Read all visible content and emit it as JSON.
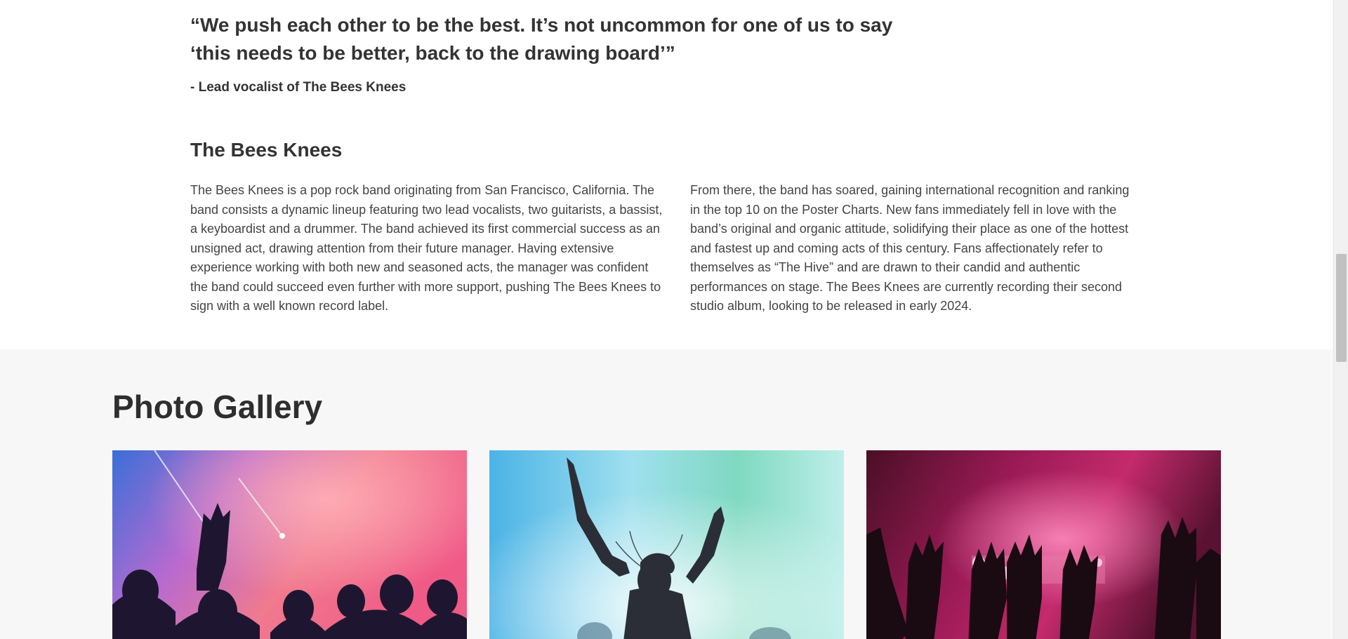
{
  "quote": {
    "text": "“We push each other to be the best. It’s not uncommon for one of us to say ‘this needs to be better, back to the drawing board’”",
    "attribution": "- Lead vocalist of The Bees Knees"
  },
  "about": {
    "heading": "The Bees Knees",
    "paragraph_left": "The Bees Knees is a pop rock band originating from San Francisco, California. The band consists a dynamic lineup featuring two lead vocalists, two guitarists, a bassist, a keyboardist and a drummer. The band achieved its first commercial success as an unsigned act, drawing attention from their future manager. Having extensive experience working with both new and seasoned acts, the manager was confident the band could succeed even further with more support, pushing The Bees Knees to sign with a well known record label.",
    "paragraph_right": "From there, the band has soared, gaining international recognition and ranking in the top 10 on the Poster Charts. New fans immediately fell in love with the band’s original and organic attitude, solidifying their place as one of the hottest and fastest up and coming acts of this century. Fans affectionately refer to themselves as “The Hive” and are drawn to their candid and authentic performances on stage. The Bees Knees are currently recording their second studio album, looking to be released in early 2024."
  },
  "gallery": {
    "title": "Photo Gallery",
    "photos": [
      {
        "subject": "concert crowd silhouettes under pink and blue stage lights"
      },
      {
        "subject": "woman dancing with raised arms in colored smoke"
      },
      {
        "subject": "raised hands silhouetted against magenta stage lights"
      }
    ]
  },
  "colors": {
    "page_bg": "#ffffff",
    "gallery_bg": "#f7f7f7",
    "text_dark": "#333333",
    "scroll_thumb": "#c1c1c1"
  }
}
